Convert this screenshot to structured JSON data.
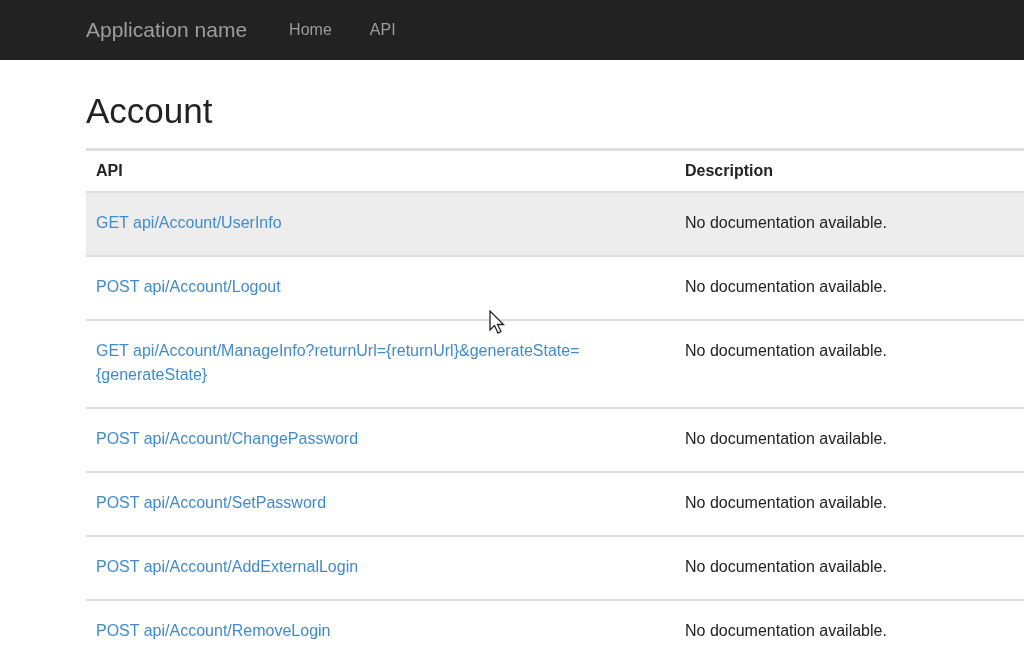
{
  "navbar": {
    "brand": "Application name",
    "links": [
      {
        "label": "Home"
      },
      {
        "label": "API"
      }
    ]
  },
  "section": {
    "title": "Account"
  },
  "table": {
    "columns": [
      "API",
      "Description"
    ],
    "rows": [
      {
        "api": "GET api/Account/UserInfo",
        "description": "No documentation available.",
        "hovered": true
      },
      {
        "api": "POST api/Account/Logout",
        "description": "No documentation available.",
        "hovered": false
      },
      {
        "api": "GET api/Account/ManageInfo?returnUrl={returnUrl}&generateState={generateState}",
        "description": "No documentation available.",
        "hovered": false
      },
      {
        "api": "POST api/Account/ChangePassword",
        "description": "No documentation available.",
        "hovered": false
      },
      {
        "api": "POST api/Account/SetPassword",
        "description": "No documentation available.",
        "hovered": false
      },
      {
        "api": "POST api/Account/AddExternalLogin",
        "description": "No documentation available.",
        "hovered": false
      },
      {
        "api": "POST api/Account/RemoveLogin",
        "description": "No documentation available.",
        "hovered": false
      }
    ]
  }
}
